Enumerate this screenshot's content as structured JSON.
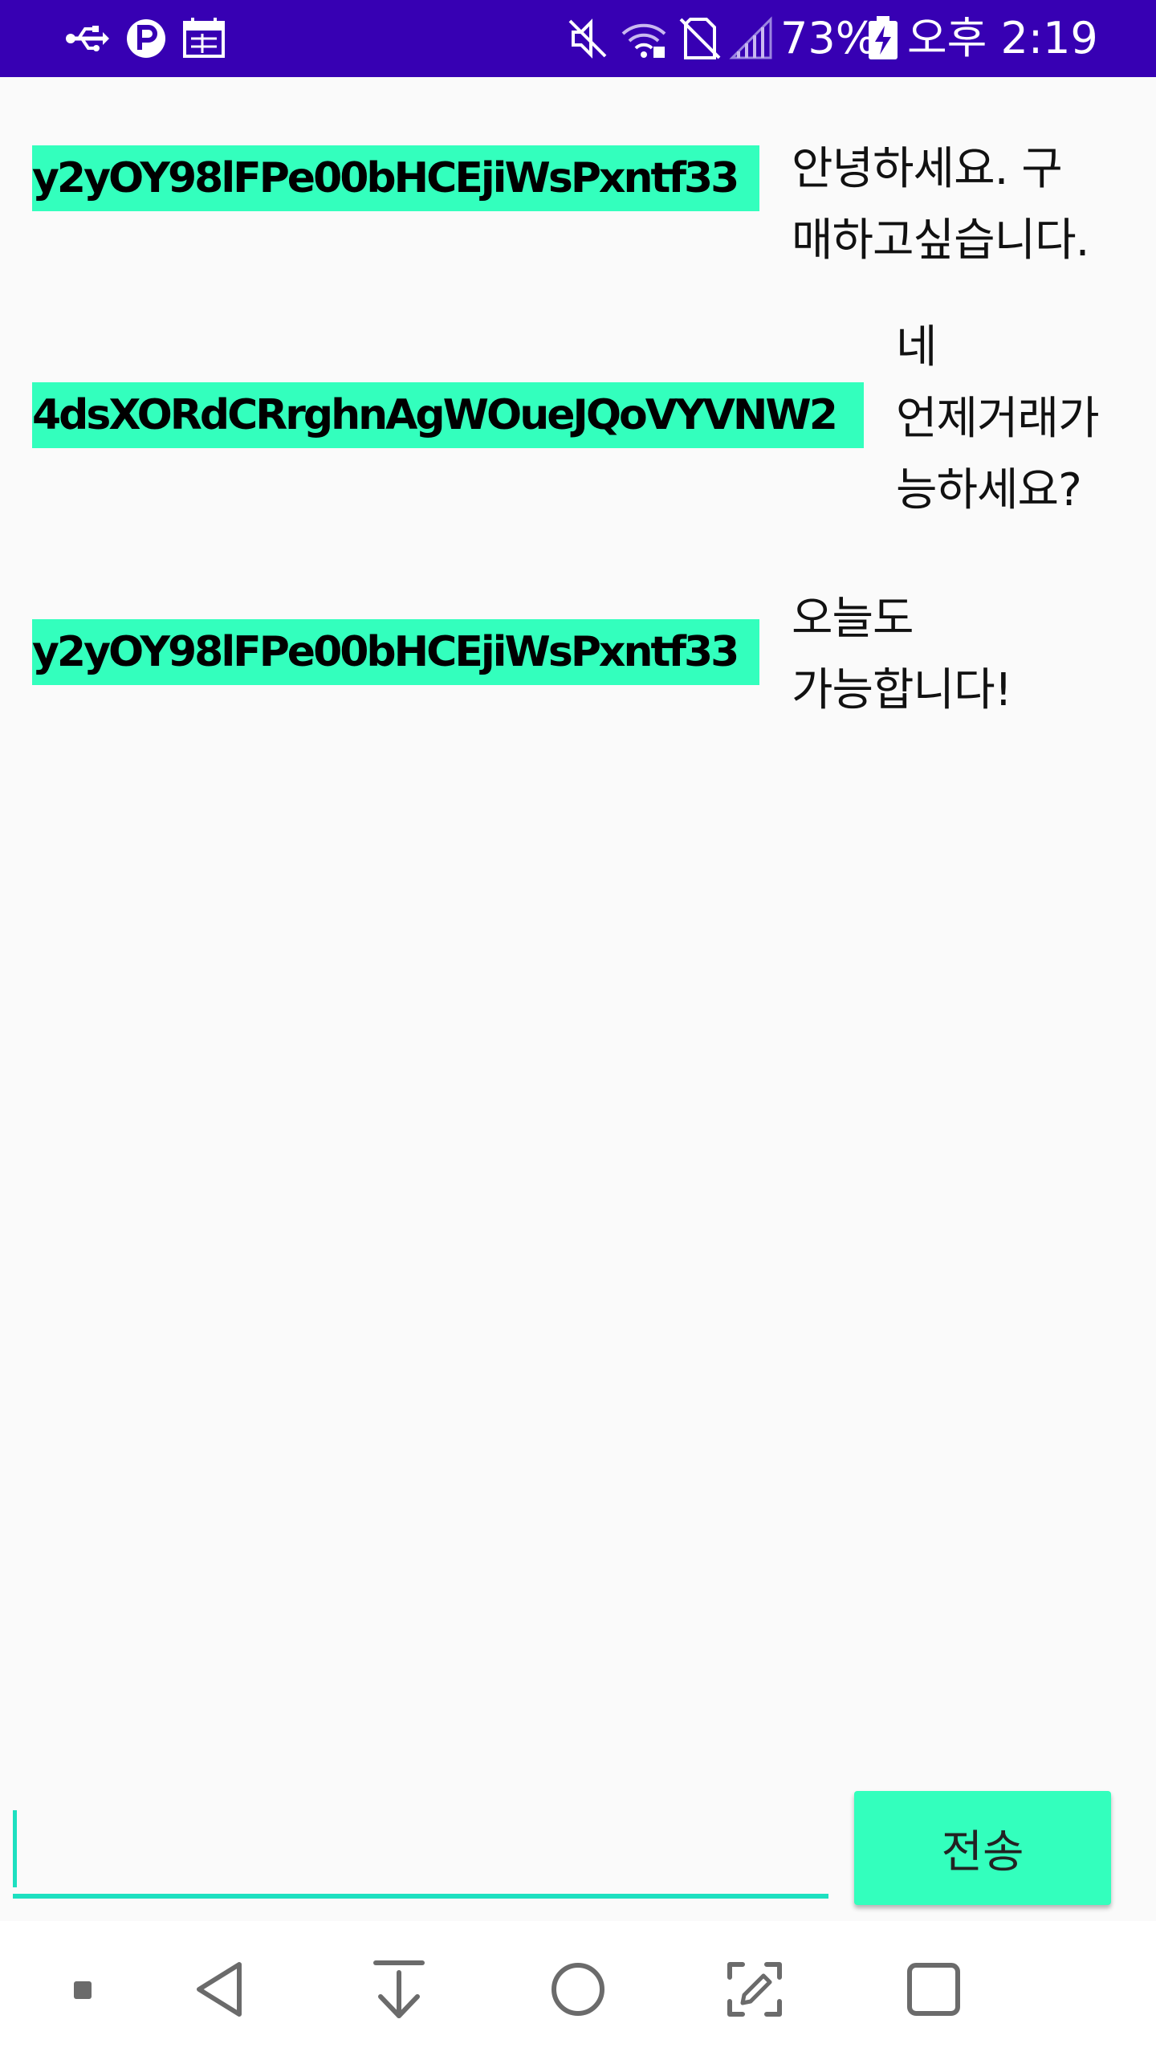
{
  "status_bar": {
    "battery_percent": "73%",
    "time": "오후 2:19",
    "icons": [
      "usb-icon",
      "p-app-icon",
      "calendar-icon",
      "mute-icon",
      "wifi-icon",
      "no-sim-icon",
      "signal-icon",
      "battery-charging-icon"
    ]
  },
  "messages": [
    {
      "sender": "y2yOY98lFPe00bHCEjiWsPxntf33",
      "text": "안녕하세요. 구\n매하고싶습니다."
    },
    {
      "sender": "4dsXORdCRrghnAgWOueJQoVYVNW2",
      "text": "네\n언제거래가\n능하세요?"
    },
    {
      "sender": "y2yOY98lFPe00bHCEjiWsPxntf33",
      "text": "오늘도\n가능합니다!"
    }
  ],
  "input": {
    "value": "",
    "placeholder": ""
  },
  "send_button": {
    "label": "전송"
  },
  "nav_bar": {
    "buttons": [
      "dot-icon",
      "back-icon",
      "down-arrow-icon",
      "home-icon",
      "screenshot-edit-icon",
      "recents-icon"
    ]
  },
  "colors": {
    "status_bar": "#3700b3",
    "accent": "#33ffbd",
    "input_underline": "#1de0c0",
    "background": "#fafafa"
  }
}
